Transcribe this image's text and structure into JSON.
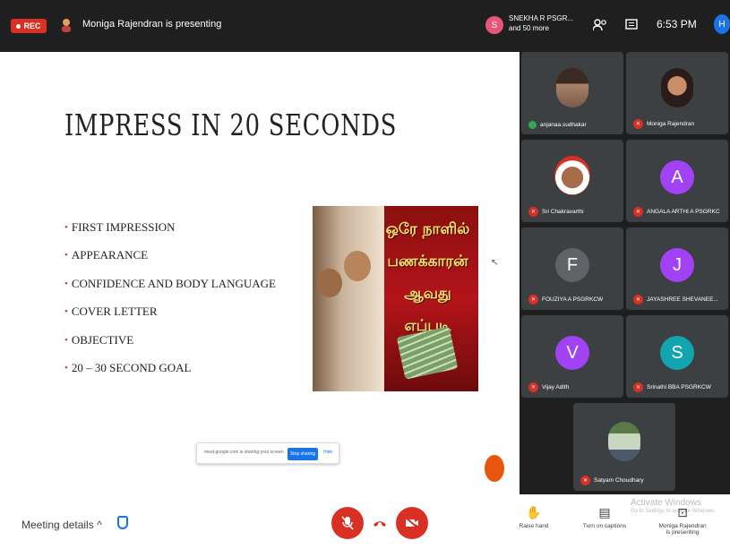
{
  "topbar": {
    "rec_label": "REC",
    "presenting_text": "Moniga Rajendran is presenting",
    "participants_badge": "S",
    "participants_line1": "SNEKHA R PSGR...",
    "participants_line2": "and 50 more",
    "clock": "6:53 PM",
    "self_initial": "H"
  },
  "slide": {
    "title": "IMPRESS IN 20 SECONDS",
    "bullets": [
      "FIRST IMPRESSION",
      "APPEARANCE",
      "CONFIDENCE AND BODY LANGUAGE",
      "COVER LETTER",
      "OBJECTIVE",
      "20 – 30 SECOND GOAL"
    ],
    "thumbnail_text": [
      "ஒரே நாளில்",
      "பணக்காரன்",
      "ஆவது எப்படி"
    ]
  },
  "share_banner": {
    "text": "meet.google.com is sharing your screen",
    "stop_label": "Stop sharing",
    "hide_label": "Hide"
  },
  "participants": [
    {
      "name": "anjanaa.sudhakar",
      "type": "photo",
      "status": "speaking"
    },
    {
      "name": "Moniga Rajendran",
      "type": "photo",
      "status": "muted"
    },
    {
      "name": "Sri Chakravarthi",
      "type": "photo",
      "status": "muted"
    },
    {
      "name": "ANGALA ARTHI A PSGRKC",
      "type": "letter",
      "initial": "A",
      "color": "#a142f4",
      "status": "muted"
    },
    {
      "name": "FOUZIYA A PSGRKCW",
      "type": "letter",
      "initial": "F",
      "color": "#5f6368",
      "status": "muted"
    },
    {
      "name": "JAYASHREE SHEVANEE...",
      "type": "letter",
      "initial": "J",
      "color": "#a142f4",
      "status": "muted"
    },
    {
      "name": "Vijay Adith",
      "type": "letter",
      "initial": "V",
      "color": "#a142f4",
      "status": "muted"
    },
    {
      "name": "Srinathi BBA PSGRKCW",
      "type": "letter",
      "initial": "S",
      "color": "#12a4af",
      "status": "muted"
    },
    {
      "name": "Satyam Choudhary",
      "type": "photo",
      "status": "muted"
    }
  ],
  "bottombar": {
    "meeting_details": "Meeting details",
    "raise_hand": "Raise hand",
    "captions": "Turn on captions",
    "presenting_line1": "Moniga Rajendran",
    "presenting_line2": "is presenting",
    "watermark_line1": "Activate Windows",
    "watermark_line2": "Go to Settings to activate Windows."
  },
  "colors": {
    "accent_red": "#d93025",
    "accent_blue": "#1a73e8",
    "dark_bg": "#1f1f1f",
    "tile_bg": "#3c4043"
  }
}
